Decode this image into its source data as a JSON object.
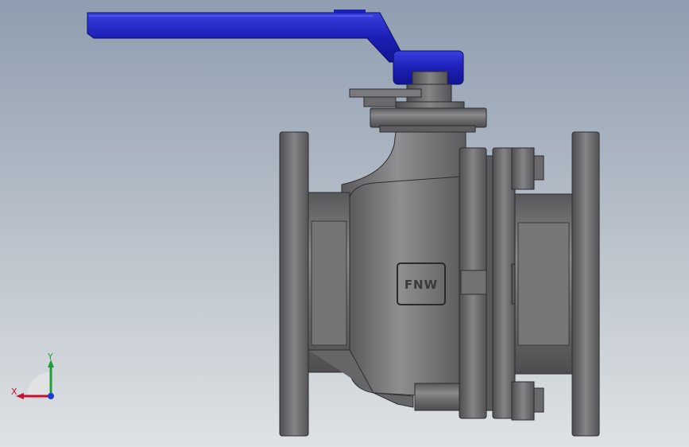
{
  "model": {
    "body_marking": "FNW"
  },
  "triad": {
    "x_label": "X",
    "y_label": "Y",
    "x_color": "#c8102e",
    "y_color": "#1f9e3a",
    "z_color": "#1a3bd6"
  },
  "colors": {
    "background_top": "#8e9db0",
    "background_bottom": "#dfe2e5",
    "handle": "#1c1fb5",
    "metal": "#6d6d70"
  }
}
